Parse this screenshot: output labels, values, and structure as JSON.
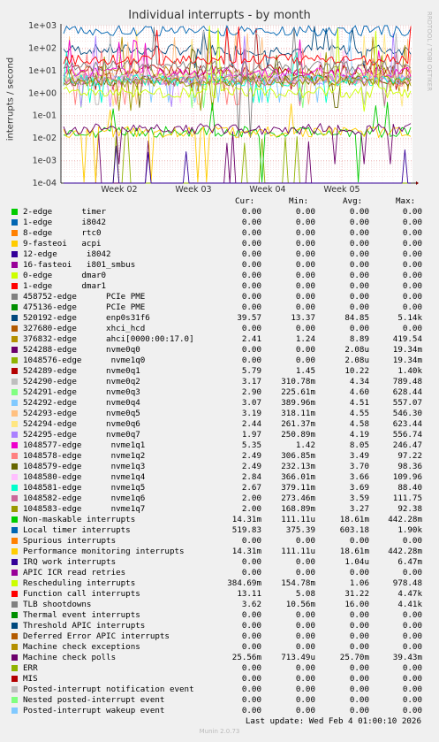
{
  "chart_data": {
    "type": "line",
    "title": "Individual interrupts - by month",
    "ylabel": "interrupts / second",
    "yscale": "log",
    "ylim": [
      0.0001,
      1000
    ],
    "yticks": [
      "1e+03",
      "1e+02",
      "1e+01",
      "1e+00",
      "1e-01",
      "1e-02",
      "1e-03",
      "1e-04"
    ],
    "xticks": [
      "Week 02",
      "Week 03",
      "Week 04",
      "Week 05"
    ],
    "grid": true,
    "series_colors": [
      "#00cc00",
      "#0066b3",
      "#ff8000",
      "#ffcc00",
      "#330099",
      "#990099",
      "#ccff00",
      "#ff0000",
      "#808080",
      "#008f00",
      "#00487d",
      "#b35a00",
      "#b38f00",
      "#6b006b",
      "#8fb300",
      "#b30000",
      "#bebebe",
      "#80ff80",
      "#80c9ff",
      "#ffc080",
      "#ffe680",
      "#aa80ff",
      "#ee00cc",
      "#ff8080",
      "#666600",
      "#ffbfff",
      "#00ffcc",
      "#cc6699",
      "#999900"
    ]
  },
  "side_text": "RRDTOOL / TOBI OETIKER",
  "legend": {
    "headers": [
      "Cur:",
      "Min:",
      "Avg:",
      "Max:"
    ],
    "rows": [
      {
        "label": "2-edge      timer",
        "color": "#00cc00",
        "cur": "0.00",
        "min": "0.00",
        "avg": "0.00",
        "max": "0.00"
      },
      {
        "label": "1-edge      i8042",
        "color": "#0066b3",
        "cur": "0.00",
        "min": "0.00",
        "avg": "0.00",
        "max": "0.00"
      },
      {
        "label": "8-edge      rtc0",
        "color": "#ff8000",
        "cur": "0.00",
        "min": "0.00",
        "avg": "0.00",
        "max": "0.00"
      },
      {
        "label": "9-fasteoi   acpi",
        "color": "#ffcc00",
        "cur": "0.00",
        "min": "0.00",
        "avg": "0.00",
        "max": "0.00"
      },
      {
        "label": "12-edge      i8042",
        "color": "#330099",
        "cur": "0.00",
        "min": "0.00",
        "avg": "0.00",
        "max": "0.00"
      },
      {
        "label": "16-fasteoi   i801_smbus",
        "color": "#990099",
        "cur": "0.00",
        "min": "0.00",
        "avg": "0.00",
        "max": "0.00"
      },
      {
        "label": "0-edge      dmar0",
        "color": "#ccff00",
        "cur": "0.00",
        "min": "0.00",
        "avg": "0.00",
        "max": "0.00"
      },
      {
        "label": "1-edge      dmar1",
        "color": "#ff0000",
        "cur": "0.00",
        "min": "0.00",
        "avg": "0.00",
        "max": "0.00"
      },
      {
        "label": "458752-edge      PCIe PME",
        "color": "#808080",
        "cur": "0.00",
        "min": "0.00",
        "avg": "0.00",
        "max": "0.00"
      },
      {
        "label": "475136-edge      PCIe PME",
        "color": "#008f00",
        "cur": "0.00",
        "min": "0.00",
        "avg": "0.00",
        "max": "0.00"
      },
      {
        "label": "520192-edge      enp0s31f6",
        "color": "#00487d",
        "cur": "39.57",
        "min": "13.37",
        "avg": "84.85",
        "max": "5.14k"
      },
      {
        "label": "327680-edge      xhci_hcd",
        "color": "#b35a00",
        "cur": "0.00",
        "min": "0.00",
        "avg": "0.00",
        "max": "0.00"
      },
      {
        "label": "376832-edge      ahci[0000:00:17.0]",
        "color": "#b38f00",
        "cur": "2.41",
        "min": "1.24",
        "avg": "8.89",
        "max": "419.54"
      },
      {
        "label": "524288-edge      nvme0q0",
        "color": "#6b006b",
        "cur": "0.00",
        "min": "0.00",
        "avg": "2.08u",
        "max": "19.34m"
      },
      {
        "label": "1048576-edge      nvme1q0",
        "color": "#8fb300",
        "cur": "0.00",
        "min": "0.00",
        "avg": "2.08u",
        "max": "19.34m"
      },
      {
        "label": "524289-edge      nvme0q1",
        "color": "#b30000",
        "cur": "5.79",
        "min": "1.45",
        "avg": "10.22",
        "max": "1.40k"
      },
      {
        "label": "524290-edge      nvme0q2",
        "color": "#bebebe",
        "cur": "3.17",
        "min": "310.78m",
        "avg": "4.34",
        "max": "789.48"
      },
      {
        "label": "524291-edge      nvme0q3",
        "color": "#80ff80",
        "cur": "2.90",
        "min": "225.61m",
        "avg": "4.60",
        "max": "628.44"
      },
      {
        "label": "524292-edge      nvme0q4",
        "color": "#80c9ff",
        "cur": "3.07",
        "min": "389.96m",
        "avg": "4.51",
        "max": "557.07"
      },
      {
        "label": "524293-edge      nvme0q5",
        "color": "#ffc080",
        "cur": "3.19",
        "min": "318.11m",
        "avg": "4.55",
        "max": "546.30"
      },
      {
        "label": "524294-edge      nvme0q6",
        "color": "#ffe680",
        "cur": "2.44",
        "min": "261.37m",
        "avg": "4.58",
        "max": "623.44"
      },
      {
        "label": "524295-edge      nvme0q7",
        "color": "#aa80ff",
        "cur": "1.97",
        "min": "250.89m",
        "avg": "4.19",
        "max": "556.74"
      },
      {
        "label": "1048577-edge      nvme1q1",
        "color": "#ee00cc",
        "cur": "5.35",
        "min": "1.42",
        "avg": "8.05",
        "max": "246.47"
      },
      {
        "label": "1048578-edge      nvme1q2",
        "color": "#ff8080",
        "cur": "2.49",
        "min": "306.85m",
        "avg": "3.49",
        "max": "97.22"
      },
      {
        "label": "1048579-edge      nvme1q3",
        "color": "#666600",
        "cur": "2.49",
        "min": "232.13m",
        "avg": "3.70",
        "max": "98.36"
      },
      {
        "label": "1048580-edge      nvme1q4",
        "color": "#ffbfff",
        "cur": "2.84",
        "min": "366.01m",
        "avg": "3.66",
        "max": "109.96"
      },
      {
        "label": "1048581-edge      nvme1q5",
        "color": "#00ffcc",
        "cur": "2.67",
        "min": "379.11m",
        "avg": "3.69",
        "max": "88.40"
      },
      {
        "label": "1048582-edge      nvme1q6",
        "color": "#cc6699",
        "cur": "2.00",
        "min": "273.46m",
        "avg": "3.59",
        "max": "111.75"
      },
      {
        "label": "1048583-edge      nvme1q7",
        "color": "#999900",
        "cur": "2.00",
        "min": "168.89m",
        "avg": "3.27",
        "max": "92.38"
      },
      {
        "label": "Non-maskable interrupts",
        "color": "#00cc00",
        "cur": "14.31m",
        "min": "111.11u",
        "avg": "18.61m",
        "max": "442.28m"
      },
      {
        "label": "Local timer interrupts",
        "color": "#0066b3",
        "cur": "519.83",
        "min": "375.39",
        "avg": "603.18",
        "max": "1.90k"
      },
      {
        "label": "Spurious interrupts",
        "color": "#ff8000",
        "cur": "0.00",
        "min": "0.00",
        "avg": "0.00",
        "max": "0.00"
      },
      {
        "label": "Performance monitoring interrupts",
        "color": "#ffcc00",
        "cur": "14.31m",
        "min": "111.11u",
        "avg": "18.61m",
        "max": "442.28m"
      },
      {
        "label": "IRQ work interrupts",
        "color": "#330099",
        "cur": "0.00",
        "min": "0.00",
        "avg": "1.04u",
        "max": "6.47m"
      },
      {
        "label": "APIC ICR read retries",
        "color": "#990099",
        "cur": "0.00",
        "min": "0.00",
        "avg": "0.00",
        "max": "0.00"
      },
      {
        "label": "Rescheduling interrupts",
        "color": "#ccff00",
        "cur": "384.69m",
        "min": "154.78m",
        "avg": "1.06",
        "max": "978.48"
      },
      {
        "label": "Function call interrupts",
        "color": "#ff0000",
        "cur": "13.11",
        "min": "5.08",
        "avg": "31.22",
        "max": "4.47k"
      },
      {
        "label": "TLB shootdowns",
        "color": "#808080",
        "cur": "3.62",
        "min": "10.56m",
        "avg": "16.00",
        "max": "4.41k"
      },
      {
        "label": "Thermal event interrupts",
        "color": "#008f00",
        "cur": "0.00",
        "min": "0.00",
        "avg": "0.00",
        "max": "0.00"
      },
      {
        "label": "Threshold APIC interrupts",
        "color": "#00487d",
        "cur": "0.00",
        "min": "0.00",
        "avg": "0.00",
        "max": "0.00"
      },
      {
        "label": "Deferred Error APIC interrupts",
        "color": "#b35a00",
        "cur": "0.00",
        "min": "0.00",
        "avg": "0.00",
        "max": "0.00"
      },
      {
        "label": "Machine check exceptions",
        "color": "#b38f00",
        "cur": "0.00",
        "min": "0.00",
        "avg": "0.00",
        "max": "0.00"
      },
      {
        "label": "Machine check polls",
        "color": "#6b006b",
        "cur": "25.56m",
        "min": "713.49u",
        "avg": "25.70m",
        "max": "39.43m"
      },
      {
        "label": "ERR",
        "color": "#8fb300",
        "cur": "0.00",
        "min": "0.00",
        "avg": "0.00",
        "max": "0.00"
      },
      {
        "label": "MIS",
        "color": "#b30000",
        "cur": "0.00",
        "min": "0.00",
        "avg": "0.00",
        "max": "0.00"
      },
      {
        "label": "Posted-interrupt notification event",
        "color": "#bebebe",
        "cur": "0.00",
        "min": "0.00",
        "avg": "0.00",
        "max": "0.00"
      },
      {
        "label": "Nested posted-interrupt event",
        "color": "#80ff80",
        "cur": "0.00",
        "min": "0.00",
        "avg": "0.00",
        "max": "0.00"
      },
      {
        "label": "Posted-interrupt wakeup event",
        "color": "#80c9ff",
        "cur": "0.00",
        "min": "0.00",
        "avg": "0.00",
        "max": "0.00"
      }
    ]
  },
  "last_update": "Last update: Wed Feb  4 01:00:10 2026",
  "footer": "Munin 2.0.73"
}
